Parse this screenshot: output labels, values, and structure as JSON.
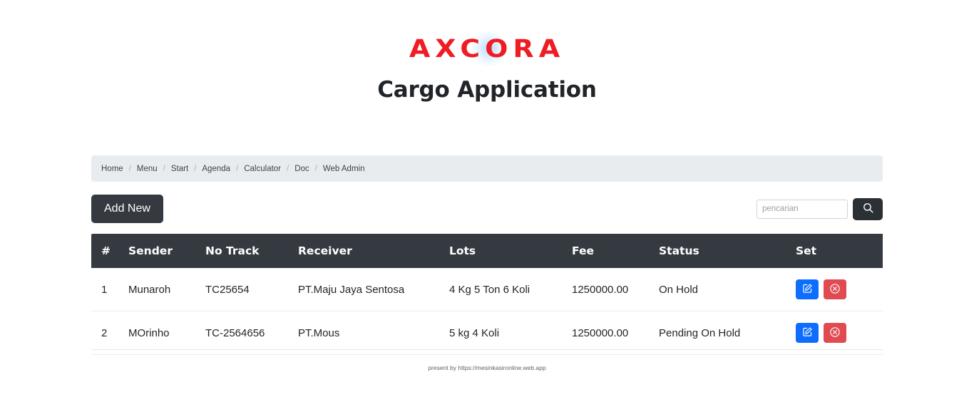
{
  "header": {
    "logo_text": "AXCORA",
    "app_title": "Cargo Application"
  },
  "breadcrumb": {
    "separator": "/",
    "items": [
      {
        "label": "Home"
      },
      {
        "label": "Menu"
      },
      {
        "label": "Start"
      },
      {
        "label": "Agenda"
      },
      {
        "label": "Calculator"
      },
      {
        "label": "Doc"
      },
      {
        "label": "Web Admin"
      }
    ]
  },
  "toolbar": {
    "add_label": "Add New",
    "search_placeholder": "pencarian",
    "search_value": "",
    "search_icon": "search-icon"
  },
  "table": {
    "columns": [
      {
        "key": "num",
        "label": "#"
      },
      {
        "key": "sender",
        "label": "Sender"
      },
      {
        "key": "track",
        "label": "No Track"
      },
      {
        "key": "receiver",
        "label": "Receiver"
      },
      {
        "key": "lots",
        "label": "Lots"
      },
      {
        "key": "fee",
        "label": "Fee"
      },
      {
        "key": "status",
        "label": "Status"
      },
      {
        "key": "set",
        "label": "Set"
      }
    ],
    "rows": [
      {
        "num": "1",
        "sender": "Munaroh",
        "track": "TC25654",
        "receiver": "PT.Maju Jaya Sentosa",
        "lots": "4 Kg 5 Ton 6 Koli",
        "fee": "1250000.00",
        "status": "On Hold",
        "edit_icon": "edit-pencil-icon",
        "delete_icon": "delete-circle-x-icon"
      },
      {
        "num": "2",
        "sender": "MOrinho",
        "track": "TC-2564656",
        "receiver": "PT.Mous",
        "lots": "5 kg 4 Koli",
        "fee": "1250000.00",
        "status": "Pending On Hold",
        "edit_icon": "edit-pencil-icon",
        "delete_icon": "delete-circle-x-icon"
      }
    ]
  },
  "footer": {
    "text": "present by https://mesinkasironline.web.app"
  },
  "colors": {
    "brand_red": "#ef1c23",
    "header_dark": "#343a40",
    "breadcrumb_bg": "#e9ecef",
    "edit_blue": "#0d6efd",
    "delete_red": "#e24a52",
    "text_dark": "#212529"
  }
}
